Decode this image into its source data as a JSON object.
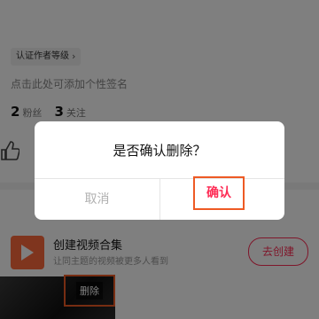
{
  "profile": {
    "author_tag": "认证作者等级",
    "signature_hint": "点击此处可添加个性签名",
    "followers_count": "2",
    "followers_label": "粉丝",
    "following_count": "3",
    "following_label": "关注"
  },
  "collection": {
    "title": "创建视频合集",
    "subtitle": "让同主题的视频被更多人看到",
    "create_button": "去创建"
  },
  "video": {
    "delete_label": "删除"
  },
  "dialog": {
    "title": "是否确认删除？",
    "cancel_label": "取消",
    "confirm_label": "确认"
  },
  "colors": {
    "accent": "#fe2c55",
    "highlight_box": "#ee5a24"
  },
  "icons": {
    "tag_chevron": "chevron-right-icon",
    "like": "thumbs-up-icon",
    "collection": "play-icon"
  }
}
